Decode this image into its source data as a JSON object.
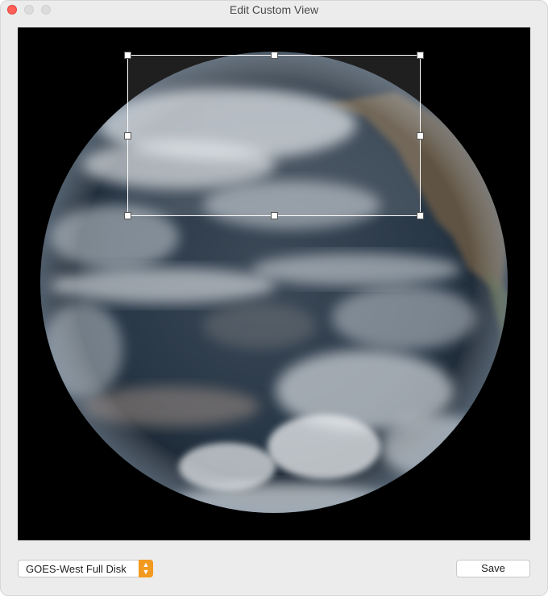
{
  "window": {
    "title": "Edit Custom View"
  },
  "controls": {
    "source_select": {
      "selected": "GOES-West Full Disk"
    },
    "save_label": "Save"
  },
  "icons": {
    "close": "close-circle",
    "minimize": "minimize-circle",
    "zoom": "zoom-circle",
    "stepper": "up-down-chevrons"
  },
  "colors": {
    "close": "#fe5f57",
    "stepper": "#f29a1f",
    "viewport_bg": "#000000"
  }
}
